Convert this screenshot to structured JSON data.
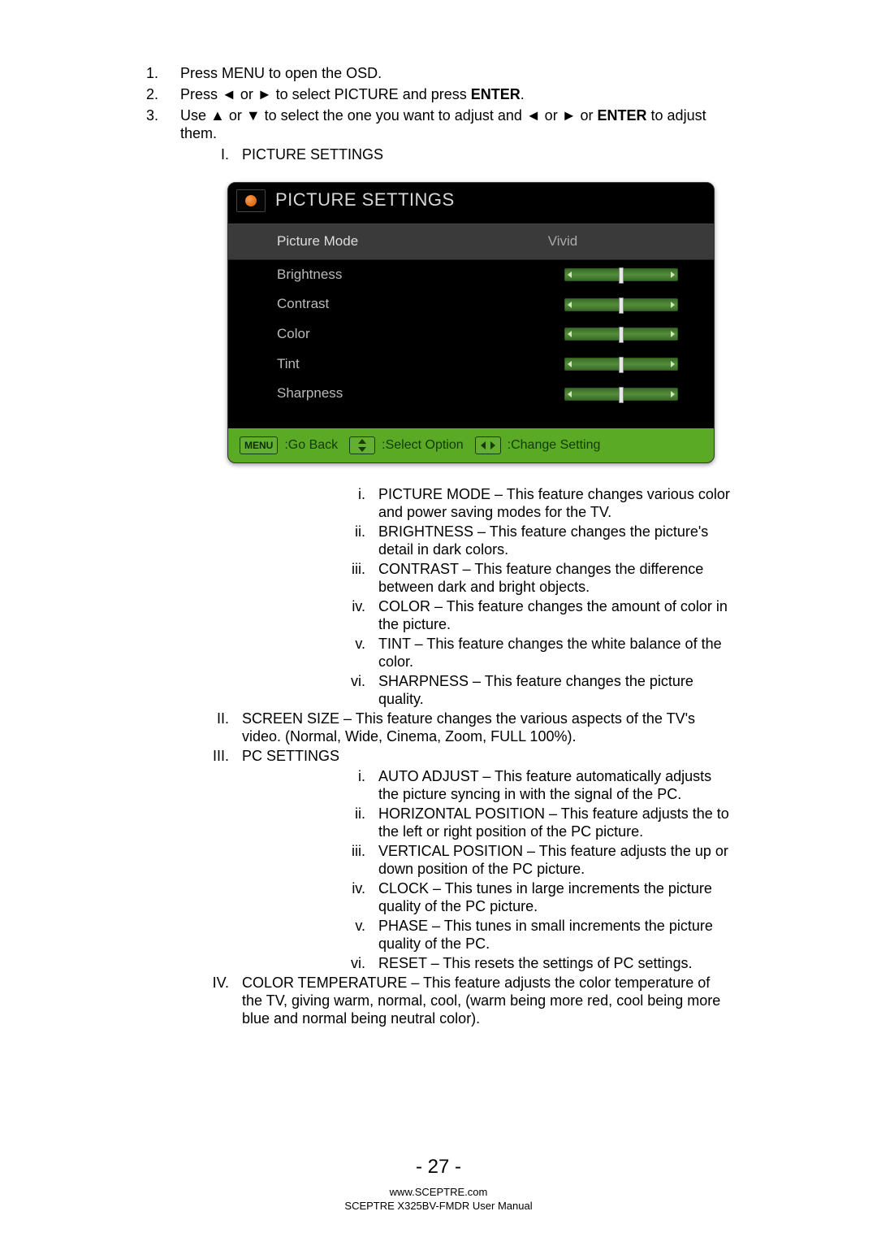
{
  "instructions": {
    "step1": "Press MENU to open the OSD.",
    "step2_a": "Press ◄ or ► to select PICTURE and press ",
    "step2_b": "ENTER",
    "step2_c": ".",
    "step3_a": "Use ▲ or ▼ to select the one you want to adjust and ◄ or ► or ",
    "step3_b": "ENTER",
    "step3_c": " to adjust them."
  },
  "sections": {
    "I": {
      "marker": "I",
      "label": "PICTURE SETTINGS"
    },
    "II": {
      "marker": "II",
      "label": "SCREEN SIZE – This feature changes the various aspects of the TV's video.  (Normal, Wide, Cinema, Zoom, FULL 100%)."
    },
    "III": {
      "marker": "III",
      "label": "PC SETTINGS"
    },
    "IV": {
      "marker": "IV",
      "label": "COLOR TEMPERATURE – This feature adjusts the color temperature of the TV, giving warm, normal, cool, (warm being more red, cool being more blue and normal being neutral color)."
    }
  },
  "picture_items": {
    "i": {
      "m": "i",
      "t": "PICTURE MODE – This feature changes various color and power saving modes for the TV."
    },
    "ii": {
      "m": "ii",
      "t": "BRIGHTNESS – This feature changes the picture's detail in dark colors."
    },
    "iii": {
      "m": "iii",
      "t": "CONTRAST – This feature changes the difference between dark and bright objects."
    },
    "iv": {
      "m": "iv",
      "t": "COLOR – This feature changes the amount of color in the picture."
    },
    "v": {
      "m": "v",
      "t": "TINT – This feature changes the white balance of the color."
    },
    "vi": {
      "m": "vi",
      "t": "SHARPNESS – This feature changes the picture quality."
    }
  },
  "pc_items": {
    "i": {
      "m": "i",
      "t": "AUTO ADJUST – This feature automatically adjusts the picture syncing in with the signal of the PC."
    },
    "ii": {
      "m": "ii",
      "t": "HORIZONTAL POSITION – This feature adjusts the to the left or right position of the PC picture."
    },
    "iii": {
      "m": "iii",
      "t": "VERTICAL POSITION – This feature adjusts the up or down position of the PC picture."
    },
    "iv": {
      "m": "iv",
      "t": "CLOCK – This tunes in large increments the picture quality of the PC picture."
    },
    "v": {
      "m": "v",
      "t": "PHASE – This tunes in small increments the picture quality of the PC."
    },
    "vi": {
      "m": "vi",
      "t": "RESET – This resets the settings of PC settings."
    }
  },
  "osd": {
    "title": "PICTURE SETTINGS",
    "rows": {
      "picture_mode": {
        "label": "Picture Mode",
        "value": "Vivid"
      },
      "brightness": {
        "label": "Brightness",
        "slider": 50
      },
      "contrast": {
        "label": "Contrast",
        "slider": 50
      },
      "color": {
        "label": "Color",
        "slider": 50
      },
      "tint": {
        "label": "Tint",
        "slider": 50
      },
      "sharpness": {
        "label": "Sharpness",
        "slider": 50
      }
    },
    "footer": {
      "menu_key": "MENU",
      "go_back": ":Go Back",
      "select_option": ":Select Option",
      "change_setting": ":Change Setting"
    }
  },
  "footer": {
    "page": "- 27 -",
    "url": "www.SCEPTRE.com",
    "manual": "SCEPTRE X325BV-FMDR User Manual"
  }
}
